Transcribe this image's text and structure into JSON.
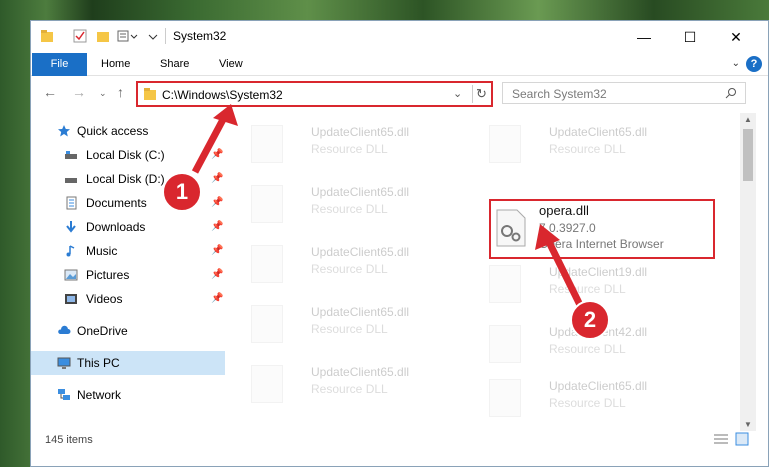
{
  "window": {
    "title": "System32"
  },
  "titlebar": {
    "minimize": "—",
    "maximize": "☐",
    "close": "✕"
  },
  "ribbon": {
    "file": "File",
    "home": "Home",
    "share": "Share",
    "view": "View",
    "help": "?"
  },
  "address": {
    "path": "C:\\Windows\\System32",
    "search_placeholder": "Search System32"
  },
  "sidebar": {
    "items": [
      {
        "label": "Quick access",
        "icon": "star-icon"
      },
      {
        "label": "Local Disk (C:)",
        "icon": "drive-icon"
      },
      {
        "label": "Local Disk (D:)",
        "icon": "drive-icon"
      },
      {
        "label": "Documents",
        "icon": "documents-icon"
      },
      {
        "label": "Downloads",
        "icon": "download-icon"
      },
      {
        "label": "Music",
        "icon": "music-icon"
      },
      {
        "label": "Pictures",
        "icon": "pictures-icon"
      },
      {
        "label": "Videos",
        "icon": "videos-icon"
      },
      {
        "label": "OneDrive",
        "icon": "cloud-icon"
      },
      {
        "label": "This PC",
        "icon": "computer-icon"
      },
      {
        "label": "Network",
        "icon": "network-icon"
      }
    ]
  },
  "files": {
    "left": [
      {
        "name": "UpdateClient65.dll",
        "desc": "Resource DLL"
      },
      {
        "name": "UpdateClient65.dll",
        "desc": "Resource DLL"
      },
      {
        "name": "UpdateClient65.dll",
        "desc": "Resource DLL"
      },
      {
        "name": "UpdateClient65.dll",
        "desc": "Resource DLL"
      },
      {
        "name": "UpdateClient65.dll",
        "desc": "Resource DLL"
      }
    ],
    "right": [
      {
        "name": "UpdateClient65.dll",
        "desc": "Resource DLL"
      },
      {
        "name": "UpdateClient19.dll",
        "desc": "Resource DLL"
      },
      {
        "name": "UpdateClient42.dll",
        "desc": "Resource DLL"
      },
      {
        "name": "UpdateClient65.dll",
        "desc": "Resource DLL"
      }
    ],
    "highlighted": {
      "name": "opera.dll",
      "version": "7.0.3927.0",
      "desc": "Opera Internet Browser"
    }
  },
  "status": {
    "count": "145 items"
  },
  "annotations": {
    "badge1": "1",
    "badge2": "2",
    "accent": "#d9272e"
  }
}
